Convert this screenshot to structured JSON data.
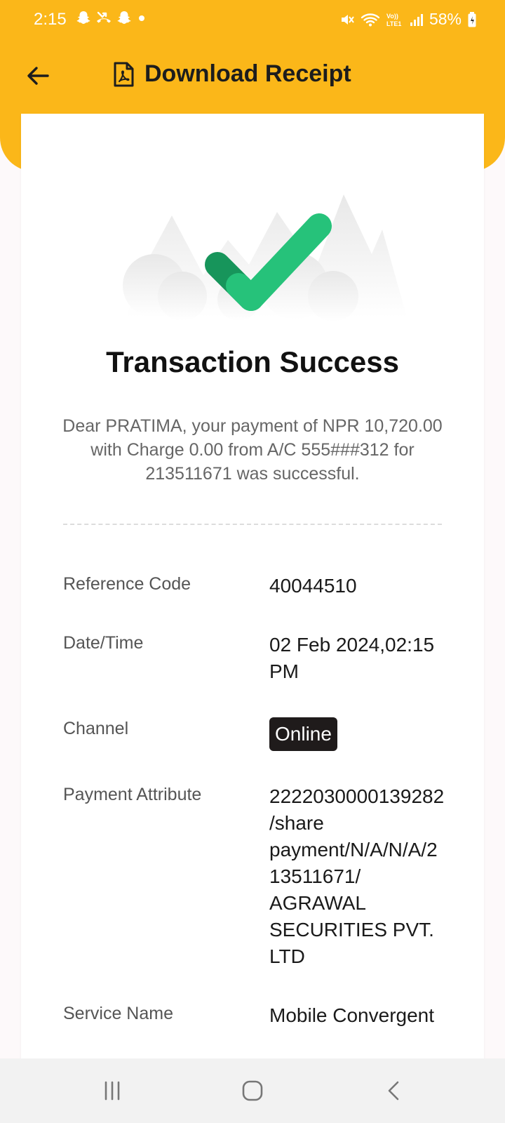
{
  "status_bar": {
    "time": "2:15",
    "battery": "58%",
    "icons": [
      "snapchat-icon",
      "missed-call-icon",
      "snapchat-icon",
      "dot-icon",
      "mute-icon",
      "wifi-icon",
      "volte-icon",
      "signal-icon",
      "battery-icon"
    ]
  },
  "header": {
    "title": "Download Receipt",
    "back_icon": "back-arrow-icon",
    "title_icon": "pdf-file-icon",
    "color": "#fbb719"
  },
  "receipt": {
    "title": "Transaction Success",
    "message": "Dear PRATIMA, your payment of NPR 10,720.00 with Charge 0.00 from A/C 555###312 for 213511671 was successful.",
    "rows": [
      {
        "label": "Reference Code",
        "value": "40044510"
      },
      {
        "label": "Date/Time",
        "value": "02 Feb 2024,02:15 PM"
      },
      {
        "label": "Channel",
        "value": "Online"
      },
      {
        "label": "Payment Attribute",
        "value": "2222030000139282/share payment/N/A/N/A/213511671/ AGRAWAL SECURITIES PVT. LTD"
      },
      {
        "label": "Service Name",
        "value": "Mobile Convergent"
      }
    ]
  },
  "navbar": {
    "icons": [
      "recent-apps-icon",
      "home-icon",
      "back-icon"
    ]
  }
}
